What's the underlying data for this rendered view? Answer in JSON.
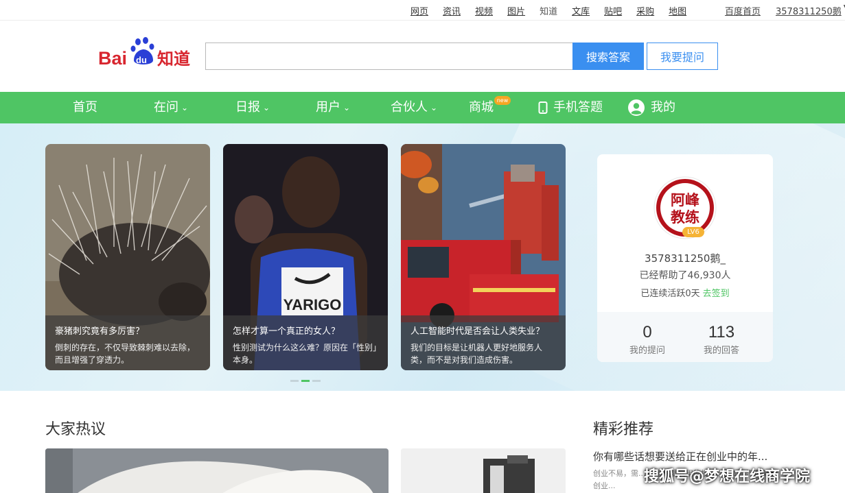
{
  "topbar": {
    "links": [
      "网页",
      "资讯",
      "视频",
      "图片",
      "知道",
      "文库",
      "贴吧",
      "采购",
      "地图"
    ],
    "home": "百度首页",
    "username": "3578311250鹅"
  },
  "header": {
    "logo_text": "Bai du 知道",
    "search_placeholder": "",
    "search_button": "搜索答案",
    "ask_button": "我要提问"
  },
  "nav": {
    "items": [
      {
        "label": "首页"
      },
      {
        "label": "在问"
      },
      {
        "label": "日报"
      },
      {
        "label": "用户"
      },
      {
        "label": "合伙人"
      },
      {
        "label": "商城"
      },
      {
        "label": "手机答题"
      },
      {
        "label": "我的"
      }
    ],
    "new_badge": "new"
  },
  "cards": [
    {
      "title": "豪猪刺究竟有多厉害？",
      "desc": "倒刺的存在，不仅导致棘刺难以去除，而且增强了穿透力。"
    },
    {
      "title": "怎样才算一个真正的女人？",
      "desc": "性别测试为什么这么难？原因在「性别」本身。",
      "bib": "YARIGO"
    },
    {
      "title": "人工智能时代是否会让人类失业？",
      "desc": "我们的目标是让机器人更好地服务人类，而不是对我们造成伤害。"
    }
  ],
  "user_panel": {
    "avatar_text": "阿峰教练",
    "level": "LV6",
    "username": "3578311250鹅_",
    "helped": "已经帮助了46,930人",
    "streak": "已连续活跃0天",
    "checkin": "去签到",
    "questions_count": "0",
    "questions_label": "我的提问",
    "answers_count": "113",
    "answers_label": "我的回答"
  },
  "sections": {
    "hot_title": "大家热议",
    "rec_title": "精彩推荐",
    "rec_item_title": "你有哪些话想要送给正在创业中的年...",
    "rec_item_desc": "创业不易，需... 创业需要受用的技能，比如：汽车美容 创业..."
  },
  "watermark": "搜狐号@梦想在线商学院",
  "colors": {
    "green": "#4fc564",
    "blue": "#3a8ff0"
  }
}
